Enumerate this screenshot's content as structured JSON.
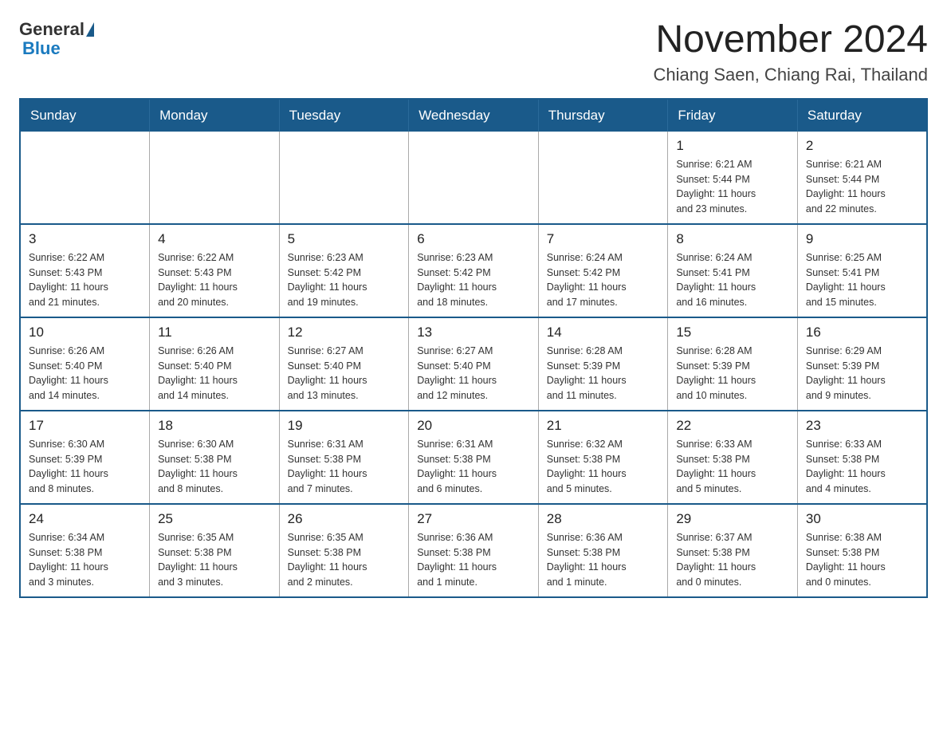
{
  "logo": {
    "general": "General",
    "triangle": "",
    "blue": "Blue"
  },
  "header": {
    "month_title": "November 2024",
    "location": "Chiang Saen, Chiang Rai, Thailand"
  },
  "days_of_week": [
    "Sunday",
    "Monday",
    "Tuesday",
    "Wednesday",
    "Thursday",
    "Friday",
    "Saturday"
  ],
  "weeks": [
    [
      {
        "day": "",
        "info": ""
      },
      {
        "day": "",
        "info": ""
      },
      {
        "day": "",
        "info": ""
      },
      {
        "day": "",
        "info": ""
      },
      {
        "day": "",
        "info": ""
      },
      {
        "day": "1",
        "info": "Sunrise: 6:21 AM\nSunset: 5:44 PM\nDaylight: 11 hours\nand 23 minutes."
      },
      {
        "day": "2",
        "info": "Sunrise: 6:21 AM\nSunset: 5:44 PM\nDaylight: 11 hours\nand 22 minutes."
      }
    ],
    [
      {
        "day": "3",
        "info": "Sunrise: 6:22 AM\nSunset: 5:43 PM\nDaylight: 11 hours\nand 21 minutes."
      },
      {
        "day": "4",
        "info": "Sunrise: 6:22 AM\nSunset: 5:43 PM\nDaylight: 11 hours\nand 20 minutes."
      },
      {
        "day": "5",
        "info": "Sunrise: 6:23 AM\nSunset: 5:42 PM\nDaylight: 11 hours\nand 19 minutes."
      },
      {
        "day": "6",
        "info": "Sunrise: 6:23 AM\nSunset: 5:42 PM\nDaylight: 11 hours\nand 18 minutes."
      },
      {
        "day": "7",
        "info": "Sunrise: 6:24 AM\nSunset: 5:42 PM\nDaylight: 11 hours\nand 17 minutes."
      },
      {
        "day": "8",
        "info": "Sunrise: 6:24 AM\nSunset: 5:41 PM\nDaylight: 11 hours\nand 16 minutes."
      },
      {
        "day": "9",
        "info": "Sunrise: 6:25 AM\nSunset: 5:41 PM\nDaylight: 11 hours\nand 15 minutes."
      }
    ],
    [
      {
        "day": "10",
        "info": "Sunrise: 6:26 AM\nSunset: 5:40 PM\nDaylight: 11 hours\nand 14 minutes."
      },
      {
        "day": "11",
        "info": "Sunrise: 6:26 AM\nSunset: 5:40 PM\nDaylight: 11 hours\nand 14 minutes."
      },
      {
        "day": "12",
        "info": "Sunrise: 6:27 AM\nSunset: 5:40 PM\nDaylight: 11 hours\nand 13 minutes."
      },
      {
        "day": "13",
        "info": "Sunrise: 6:27 AM\nSunset: 5:40 PM\nDaylight: 11 hours\nand 12 minutes."
      },
      {
        "day": "14",
        "info": "Sunrise: 6:28 AM\nSunset: 5:39 PM\nDaylight: 11 hours\nand 11 minutes."
      },
      {
        "day": "15",
        "info": "Sunrise: 6:28 AM\nSunset: 5:39 PM\nDaylight: 11 hours\nand 10 minutes."
      },
      {
        "day": "16",
        "info": "Sunrise: 6:29 AM\nSunset: 5:39 PM\nDaylight: 11 hours\nand 9 minutes."
      }
    ],
    [
      {
        "day": "17",
        "info": "Sunrise: 6:30 AM\nSunset: 5:39 PM\nDaylight: 11 hours\nand 8 minutes."
      },
      {
        "day": "18",
        "info": "Sunrise: 6:30 AM\nSunset: 5:38 PM\nDaylight: 11 hours\nand 8 minutes."
      },
      {
        "day": "19",
        "info": "Sunrise: 6:31 AM\nSunset: 5:38 PM\nDaylight: 11 hours\nand 7 minutes."
      },
      {
        "day": "20",
        "info": "Sunrise: 6:31 AM\nSunset: 5:38 PM\nDaylight: 11 hours\nand 6 minutes."
      },
      {
        "day": "21",
        "info": "Sunrise: 6:32 AM\nSunset: 5:38 PM\nDaylight: 11 hours\nand 5 minutes."
      },
      {
        "day": "22",
        "info": "Sunrise: 6:33 AM\nSunset: 5:38 PM\nDaylight: 11 hours\nand 5 minutes."
      },
      {
        "day": "23",
        "info": "Sunrise: 6:33 AM\nSunset: 5:38 PM\nDaylight: 11 hours\nand 4 minutes."
      }
    ],
    [
      {
        "day": "24",
        "info": "Sunrise: 6:34 AM\nSunset: 5:38 PM\nDaylight: 11 hours\nand 3 minutes."
      },
      {
        "day": "25",
        "info": "Sunrise: 6:35 AM\nSunset: 5:38 PM\nDaylight: 11 hours\nand 3 minutes."
      },
      {
        "day": "26",
        "info": "Sunrise: 6:35 AM\nSunset: 5:38 PM\nDaylight: 11 hours\nand 2 minutes."
      },
      {
        "day": "27",
        "info": "Sunrise: 6:36 AM\nSunset: 5:38 PM\nDaylight: 11 hours\nand 1 minute."
      },
      {
        "day": "28",
        "info": "Sunrise: 6:36 AM\nSunset: 5:38 PM\nDaylight: 11 hours\nand 1 minute."
      },
      {
        "day": "29",
        "info": "Sunrise: 6:37 AM\nSunset: 5:38 PM\nDaylight: 11 hours\nand 0 minutes."
      },
      {
        "day": "30",
        "info": "Sunrise: 6:38 AM\nSunset: 5:38 PM\nDaylight: 11 hours\nand 0 minutes."
      }
    ]
  ]
}
